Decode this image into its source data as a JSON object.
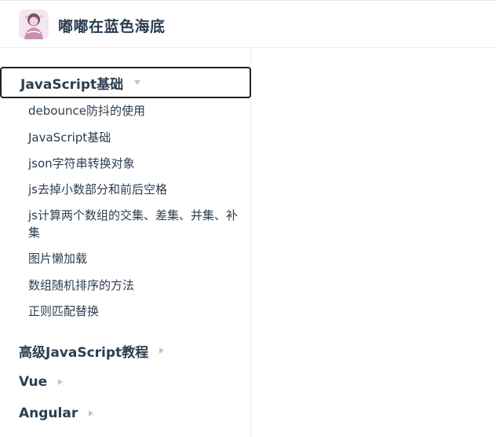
{
  "header": {
    "site_title": "嘟嘟在蓝色海底",
    "logo_icon": "avatar-logo-icon"
  },
  "sidebar": {
    "groups": [
      {
        "label": "JavaScript基础",
        "expanded": true,
        "items": [
          "debounce防抖的使用",
          "JavaScript基础",
          "json字符串转换对象",
          "js去掉小数部分和前后空格",
          "js计算两个数组的交集、差集、并集、补集",
          "图片懒加载",
          "数组随机排序的方法",
          "正则匹配替换"
        ]
      },
      {
        "label": "高级JavaScript教程",
        "expanded": false
      },
      {
        "label": "Vue",
        "expanded": false
      },
      {
        "label": "Angular",
        "expanded": false
      }
    ]
  },
  "colors": {
    "text": "#2c3e50",
    "border": "#eaecef",
    "arrow": "#c5c5c5"
  }
}
